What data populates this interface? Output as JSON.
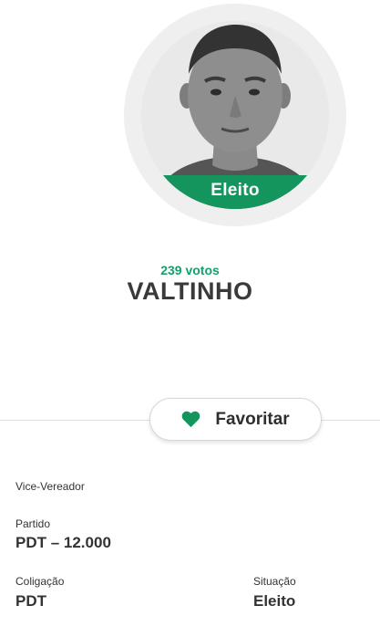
{
  "candidate": {
    "status_badge": "Eleito",
    "votes": "239 votos",
    "name": "VALTINHO"
  },
  "actions": {
    "favorite_label": "Favoritar"
  },
  "details": {
    "role": "Vice-Vereador",
    "party_label": "Partido",
    "party_value": "PDT – 12.000",
    "coalition_label": "Coligação",
    "coalition_value": "PDT",
    "situation_label": "Situação",
    "situation_value": "Eleito"
  },
  "colors": {
    "accent": "#14955e",
    "votes": "#13a06a"
  },
  "icons": {
    "favorite": "heart-icon"
  }
}
